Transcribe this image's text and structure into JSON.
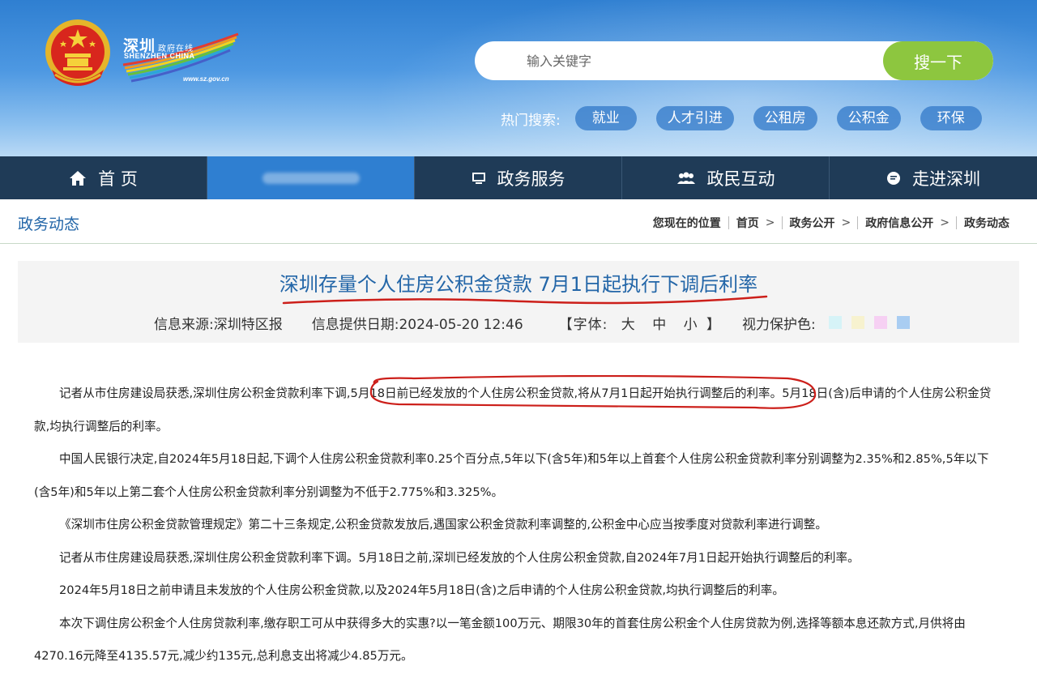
{
  "header": {
    "logo_cn": "深圳",
    "logo_cn_small": "政府在线",
    "logo_en": "SHENZHEN CHINA",
    "logo_url": "www.sz.gov.cn",
    "search": {
      "placeholder": "输入关键字",
      "button": "搜一下"
    },
    "hot_label": "热门搜索:",
    "hot_tags": [
      "就业",
      "人才引进",
      "公租房",
      "公积金",
      "环保"
    ]
  },
  "nav": {
    "items": [
      {
        "label": "首 页",
        "icon": "home-icon"
      },
      {
        "label": "",
        "icon": ""
      },
      {
        "label": "政务服务",
        "icon": "monitor-icon"
      },
      {
        "label": "政民互动",
        "icon": "people-icon"
      },
      {
        "label": "走进深圳",
        "icon": "chat-bubble-icon"
      }
    ]
  },
  "breadcrumb": {
    "section_title": "政务动态",
    "prefix": "您现在的位置",
    "items": [
      "首页",
      "政务公开",
      "政府信息公开",
      "政务动态"
    ]
  },
  "article": {
    "title": "深圳存量个人住房公积金贷款 7月1日起执行下调后利率",
    "source": "信息来源:深圳特区报",
    "date": "信息提供日期:2024-05-20 12:46",
    "font_label": "【字体:",
    "font_sizes": [
      "大",
      "中",
      "小"
    ],
    "font_close": "】",
    "eye_label": "视力保护色:",
    "eye_colors": [
      "#d6f3f7",
      "#f7f2cf",
      "#f6d0f3",
      "#a9cdf2"
    ],
    "paragraphs": [
      {
        "pre": "记者从市住房建设局获悉,深圳住房公积金贷款利率下调,",
        "highlight": "5月18日前已经发放的个人住房公积金贷款,将从7月1日起开始执行调整后的利率。",
        "post": "5月18日(含)后申请的个人住房公积金贷款,均执行调整后的利率。"
      },
      {
        "text": "中国人民银行决定,自2024年5月18日起,下调个人住房公积金贷款利率0.25个百分点,5年以下(含5年)和5年以上首套个人住房公积金贷款利率分别调整为2.35%和2.85%,5年以下(含5年)和5年以上第二套个人住房公积金贷款利率分别调整为不低于2.775%和3.325%。"
      },
      {
        "text": "《深圳市住房公积金贷款管理规定》第二十三条规定,公积金贷款发放后,遇国家公积金贷款利率调整的,公积金中心应当按季度对贷款利率进行调整。"
      },
      {
        "text": "记者从市住房建设局获悉,深圳住房公积金贷款利率下调。5月18日之前,深圳已经发放的个人住房公积金贷款,自2024年7月1日起开始执行调整后的利率。"
      },
      {
        "text": "2024年5月18日之前申请且未发放的个人住房公积金贷款,以及2024年5月18日(含)之后申请的个人住房公积金贷款,均执行调整后的利率。"
      },
      {
        "text": "本次下调住房公积金个人住房贷款利率,缴存职工可从中获得多大的实惠?以一笔金额100万元、期限30年的首套住房公积金个人住房贷款为例,选择等额本息还款方式,月供将由4270.16元降至4135.57元,减少约135元,总利息支出将减少4.85万元。"
      }
    ]
  }
}
